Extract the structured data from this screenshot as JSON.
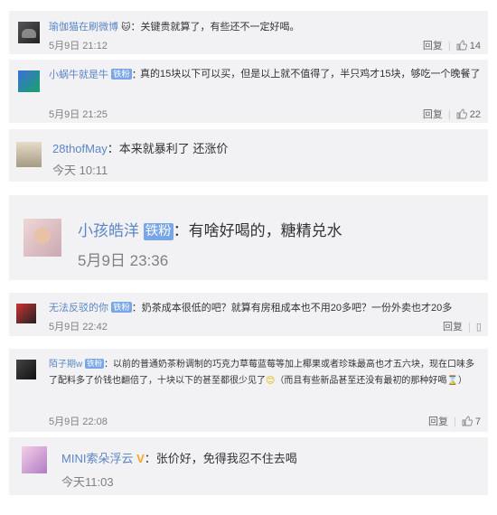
{
  "comments": [
    {
      "name": "瑜伽猫在刷微博",
      "emoji": "🐱",
      "sep": "：",
      "text": "关键贵就算了，有些还不一定好喝。",
      "time": "5月9日 21:12",
      "reply": "回复",
      "likes": "14"
    },
    {
      "name": "小蜗牛就是牛",
      "badge": "铁粉",
      "sep": "：",
      "text": "真的15块以下可以买，但是以上就不值得了，半只鸡才15块，够吃一个晚餐了",
      "time": "5月9日 21:25",
      "reply": "回复",
      "likes": "22"
    },
    {
      "name": "28thofMay",
      "sep": "：",
      "text": "本来就暴利了 还涨价",
      "time": "今天 10:11"
    },
    {
      "name": "小孩皓洋",
      "badge": "铁粉",
      "sep": "：",
      "text": "有啥好喝的，糖精兑水",
      "time": "5月9日 23:36"
    },
    {
      "name": "无法反驳的你",
      "badge": "铁粉",
      "sep": "：",
      "text": "奶茶成本很低的吧？就算有房租成本也不用20多吧？一份外卖也才20多",
      "time": "5月9日 22:42",
      "reply": "回复"
    },
    {
      "name": "陌子期w",
      "badge": "铁粉",
      "sep": "：",
      "text_line1": "以前的普通奶茶粉调制的巧克力草莓蓝莓等加上椰果或者珍珠最高也才五六块，现",
      "text_line2": "在口味多了配料多了价钱也翻倍了，十块以下的甚至都很少见了",
      "text_line3": "（而且有些新品甚至还没有最",
      "text_line4": "初的那种好喝",
      "text_line5": "）",
      "time": "5月9日 22:08",
      "reply": "回复",
      "likes": "7"
    },
    {
      "name": "MINI索朵浮云",
      "vip": "V",
      "sep": "：",
      "text": "张价好，免得我忍不住去喝",
      "time": "今天11:03"
    }
  ],
  "colors": {
    "card_bg": "#f2f2f5",
    "name": "#eb7350",
    "badge": "#78a6e6",
    "vip": "#f5a623"
  }
}
